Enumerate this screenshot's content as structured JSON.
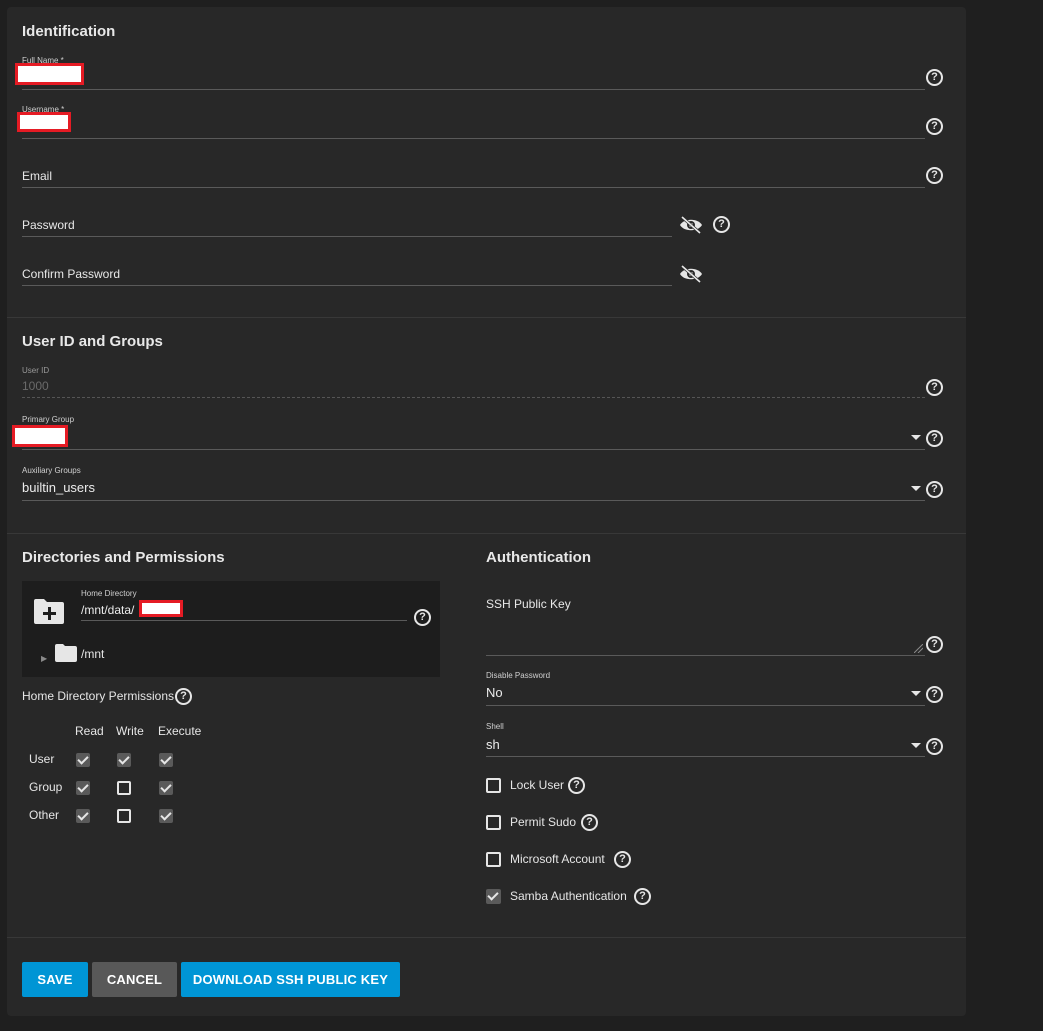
{
  "colors": {
    "background": "#1f1f1f",
    "card": "#282828",
    "primary_button": "#0095d5",
    "secondary_button": "#585858",
    "redaction_border": "#e51b24"
  },
  "identification": {
    "title": "Identification",
    "full_name": {
      "label": "Full Name *",
      "value": ""
    },
    "username": {
      "label": "Username *",
      "value": ""
    },
    "email": {
      "label": "Email"
    },
    "password": {
      "label": "Password"
    },
    "confirm_password": {
      "label": "Confirm Password"
    }
  },
  "user_id_groups": {
    "title": "User ID and Groups",
    "user_id": {
      "label": "User ID",
      "value": "1000"
    },
    "primary_group": {
      "label": "Primary Group",
      "value": ""
    },
    "auxiliary_groups": {
      "label": "Auxiliary Groups",
      "value": "builtin_users"
    }
  },
  "directories": {
    "title": "Directories and Permissions",
    "home_directory": {
      "label": "Home Directory",
      "value": "/mnt/data/"
    },
    "tree_root": "/mnt",
    "permissions_label": "Home Directory Permissions",
    "columns": [
      "Read",
      "Write",
      "Execute"
    ],
    "rows": [
      {
        "label": "User",
        "read": true,
        "write": true,
        "execute": true
      },
      {
        "label": "Group",
        "read": true,
        "write": false,
        "execute": true
      },
      {
        "label": "Other",
        "read": true,
        "write": false,
        "execute": true
      }
    ]
  },
  "authentication": {
    "title": "Authentication",
    "ssh_public_key": {
      "label": "SSH Public Key"
    },
    "disable_password": {
      "label": "Disable Password",
      "value": "No"
    },
    "shell": {
      "label": "Shell",
      "value": "sh"
    },
    "checkboxes": [
      {
        "label": "Lock User",
        "checked": false
      },
      {
        "label": "Permit Sudo",
        "checked": false
      },
      {
        "label": "Microsoft Account",
        "checked": false
      },
      {
        "label": "Samba Authentication",
        "checked": true
      }
    ]
  },
  "actions": {
    "save": "SAVE",
    "cancel": "CANCEL",
    "download_key": "DOWNLOAD SSH PUBLIC KEY"
  },
  "icons": {
    "help": "help-circle-icon",
    "eye_off": "eye-off-icon",
    "dropdown": "caret-down-icon",
    "folder_add": "folder-plus-icon",
    "folder": "folder-icon",
    "expand": "expand-arrow-icon"
  },
  "glyphs": {
    "help": "?",
    "expand": "▶"
  }
}
